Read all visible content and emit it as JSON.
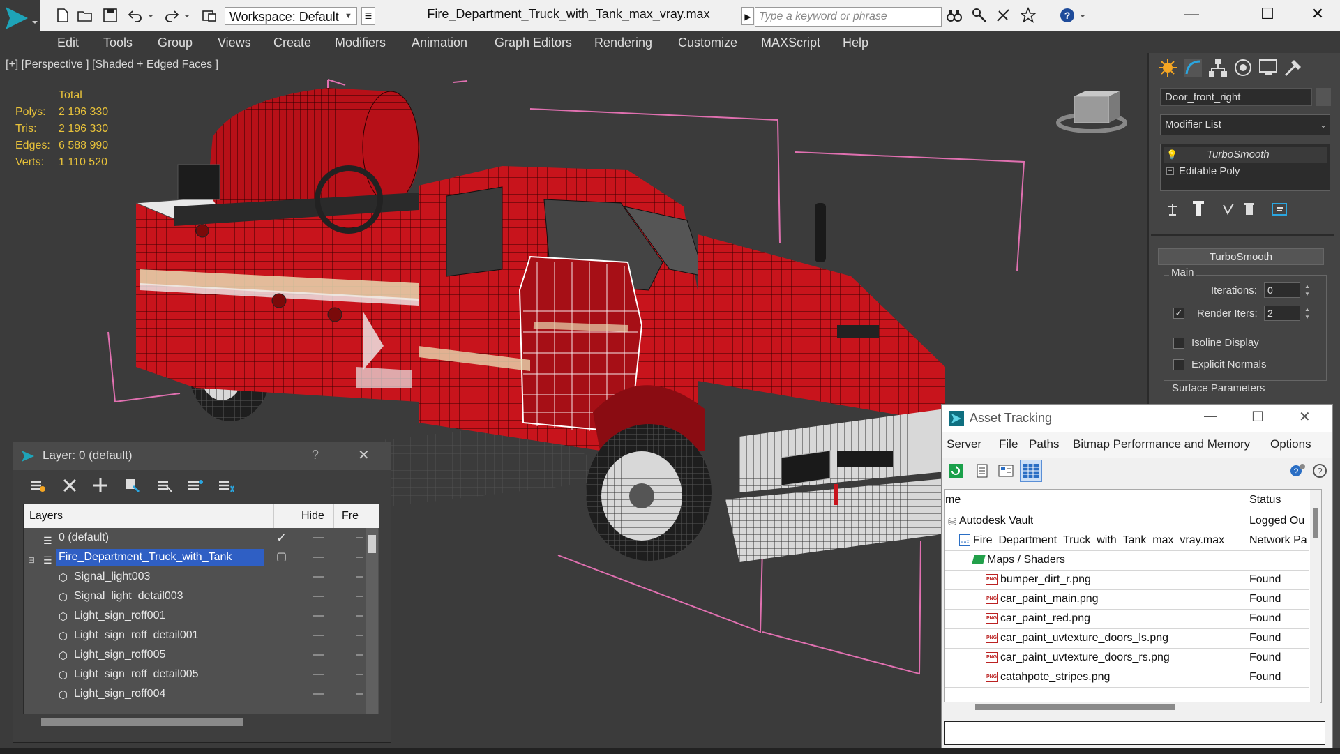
{
  "window": {
    "title": "Fire_Department_Truck_with_Tank_max_vray.max",
    "workspace": "Workspace: Default",
    "search_placeholder": "Type a keyword or phrase",
    "minimize": "—",
    "maximize": "☐",
    "close": "✕"
  },
  "menu": [
    "Edit",
    "Tools",
    "Group",
    "Views",
    "Create",
    "Modifiers",
    "Animation",
    "Graph Editors",
    "Rendering",
    "Customize",
    "MAXScript",
    "Help"
  ],
  "viewport": {
    "label": "[+] [Perspective ] [Shaded + Edged Faces ]",
    "stats": {
      "header": "Total",
      "rows": [
        {
          "label": "Polys:",
          "value": "2 196 330"
        },
        {
          "label": "Tris:",
          "value": "2 196 330"
        },
        {
          "label": "Edges:",
          "value": "6 588 990"
        },
        {
          "label": "Verts:",
          "value": "1 110 520"
        }
      ]
    },
    "colors": {
      "body_red": "#c8141c",
      "wire": "#3a0000",
      "selection_box": "#e070b0",
      "stats_text": "#e8c23a"
    }
  },
  "command_panel": {
    "object_name": "Door_front_right",
    "modifier_list": "Modifier List",
    "stack": [
      "TurboSmooth",
      "Editable Poly"
    ],
    "turbosmooth": {
      "title": "TurboSmooth",
      "group_main": "Main",
      "iterations_label": "Iterations:",
      "iterations_value": "0",
      "render_iters_label": "Render Iters:",
      "render_iters_value": "2",
      "render_iters_checked": "✓",
      "isoline_label": "Isoline Display",
      "explicit_normals_label": "Explicit Normals",
      "surface_params": "Surface Parameters"
    }
  },
  "layer_window": {
    "title": "Layer: 0 (default)",
    "help": "?",
    "close": "✕",
    "columns": {
      "layers": "Layers",
      "hide": "Hide",
      "freeze": "Fre"
    },
    "rows": [
      {
        "name": "0 (default)",
        "check": "✓"
      },
      {
        "name": "Fire_Department_Truck_with_Tank",
        "check": "▢"
      },
      {
        "name": "Signal_light003"
      },
      {
        "name": "Signal_light_detail003"
      },
      {
        "name": "Light_sign_roff001"
      },
      {
        "name": "Light_sign_roff_detail001"
      },
      {
        "name": "Light_sign_roff005"
      },
      {
        "name": "Light_sign_roff_detail005"
      },
      {
        "name": "Light_sign_roff004"
      }
    ]
  },
  "asset_window": {
    "title": "Asset Tracking",
    "minimize": "—",
    "maximize": "☐",
    "close": "✕",
    "menu": [
      "Server",
      "File",
      "Paths",
      "Bitmap Performance and Memory",
      "Options"
    ],
    "columns": {
      "name": "me",
      "status": "Status"
    },
    "rows": [
      {
        "name": "Autodesk Vault",
        "status": "Logged Ou"
      },
      {
        "name": "Fire_Department_Truck_with_Tank_max_vray.max",
        "status": "Network Pa"
      },
      {
        "name": "Maps / Shaders",
        "status": ""
      },
      {
        "name": "bumper_dirt_r.png",
        "status": "Found"
      },
      {
        "name": "car_paint_main.png",
        "status": "Found"
      },
      {
        "name": "car_paint_red.png",
        "status": "Found"
      },
      {
        "name": "car_paint_uvtexture_doors_ls.png",
        "status": "Found"
      },
      {
        "name": "car_paint_uvtexture_doors_rs.png",
        "status": "Found"
      },
      {
        "name": "catahpote_stripes.png",
        "status": "Found"
      }
    ]
  }
}
